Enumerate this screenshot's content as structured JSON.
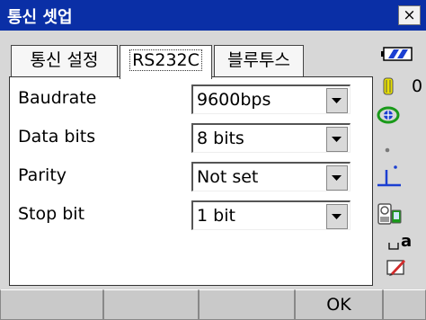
{
  "window": {
    "title": "통신 셋업",
    "close_label": "×"
  },
  "tabs": [
    {
      "label": "통신 설정",
      "active": false
    },
    {
      "label": "RS232C",
      "active": true
    },
    {
      "label": "블루투스",
      "active": false
    }
  ],
  "fields": [
    {
      "label": "Baudrate",
      "value": "9600bps"
    },
    {
      "label": "Data bits",
      "value": "8 bits"
    },
    {
      "label": "Parity",
      "value": "Not set"
    },
    {
      "label": "Stop bit",
      "value": "1 bit"
    }
  ],
  "status": {
    "battery_level": "0",
    "icons": [
      "battery-icon",
      "prism-battery-icon",
      "target-icon",
      "dot-icon",
      "tilt-icon",
      "instrument-icon",
      "input-mode-icon",
      "edit-icon"
    ],
    "input_mode_label": "a"
  },
  "softkeys": [
    "",
    "",
    "",
    "OK",
    ""
  ],
  "colors": {
    "titlebar": "#0a2fa6",
    "accent_green": "#1a9a1a",
    "accent_blue": "#1b3fd1"
  }
}
